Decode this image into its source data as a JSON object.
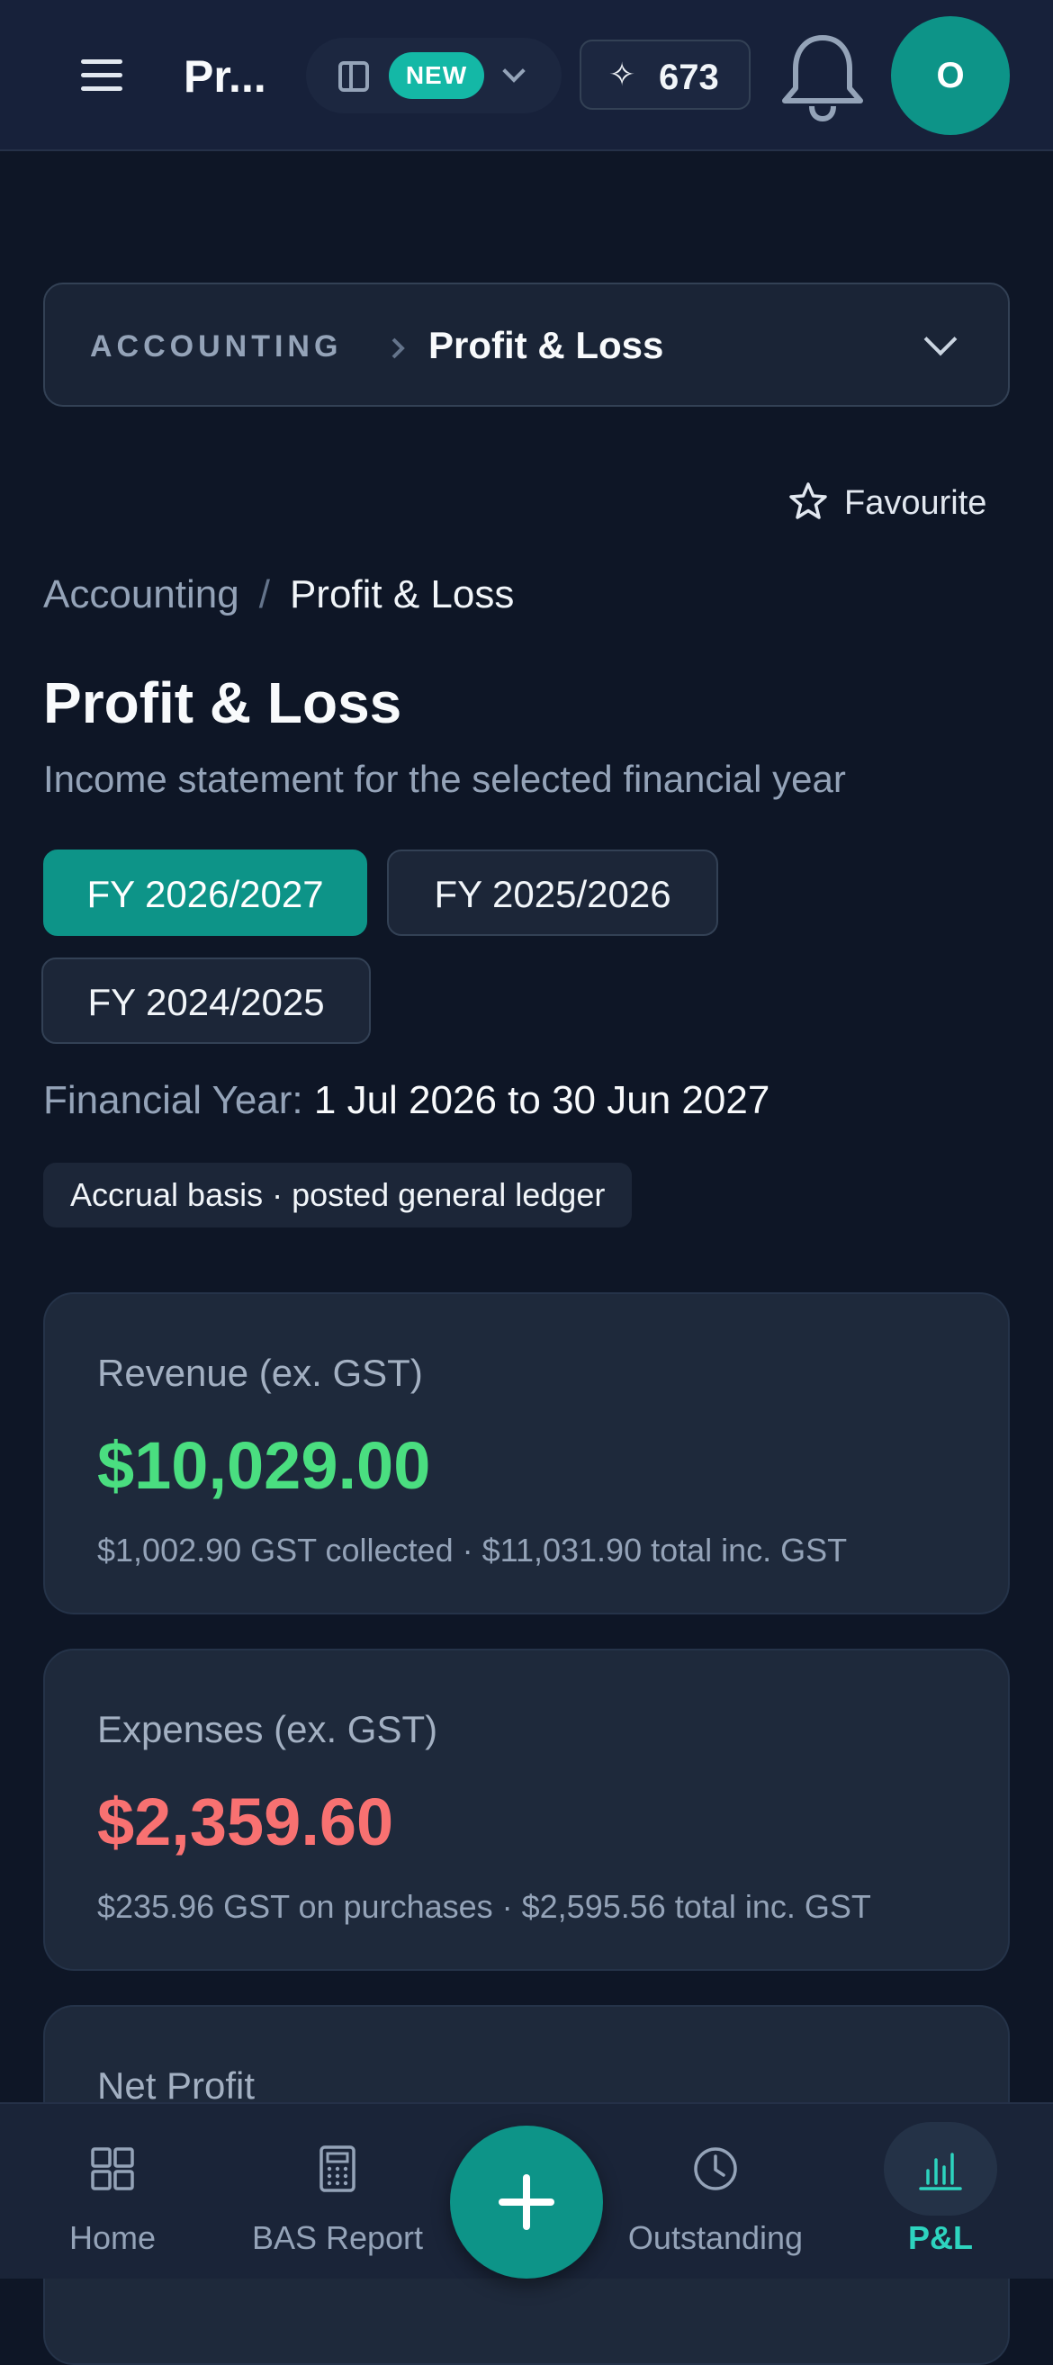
{
  "header": {
    "app_title": "Pr...",
    "new_badge": "NEW",
    "credits": "673",
    "avatar_initial": "O"
  },
  "section_select": {
    "section": "ACCOUNTING",
    "page": "Profit & Loss"
  },
  "favourite_label": "Favourite",
  "breadcrumb": {
    "parent": "Accounting",
    "separator": "/",
    "current": "Profit & Loss"
  },
  "page": {
    "title": "Profit & Loss",
    "subtitle": "Income statement for the selected financial year"
  },
  "financial_years": [
    {
      "label": "FY 2026/2027",
      "active": true
    },
    {
      "label": "FY 2025/2026",
      "active": false
    },
    {
      "label": "FY 2024/2025",
      "active": false
    }
  ],
  "financial_year_range": {
    "label": "Financial Year:",
    "value": "1 Jul 2026 to 30 Jun 2027"
  },
  "basis_pill": "Accrual basis · posted general ledger",
  "cards": {
    "revenue": {
      "label": "Revenue (ex. GST)",
      "amount": "$10,029.00",
      "note": "$1,002.90 GST collected · $11,031.90 total inc. GST",
      "color": "#4ade80"
    },
    "expenses": {
      "label": "Expenses (ex. GST)",
      "amount": "$2,359.60",
      "note": "$235.96 GST on purchases · $2,595.56 total inc. GST",
      "color": "#f87171"
    },
    "net_profit": {
      "label": "Net Profit"
    }
  },
  "bottom_nav": {
    "home": "Home",
    "bas": "BAS Report",
    "outstanding": "Outstanding",
    "pl": "P&L"
  },
  "colors": {
    "accent": "#0d9488",
    "active_nav": "#2dd4bf",
    "background": "#0e1626"
  }
}
